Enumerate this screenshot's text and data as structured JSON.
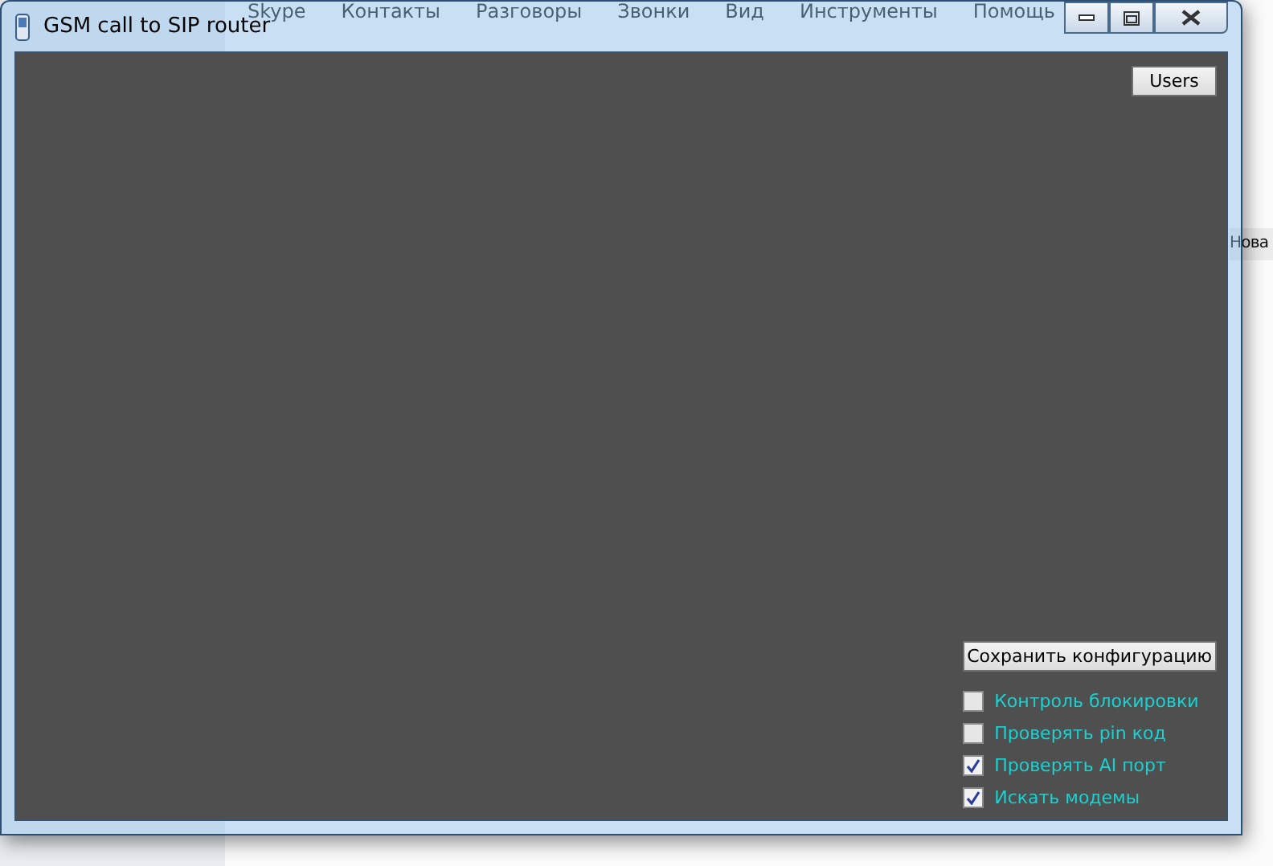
{
  "background_window": {
    "menu": [
      "Skype",
      "Контакты",
      "Разговоры",
      "Звонки",
      "Вид",
      "Инструменты",
      "Помощь"
    ],
    "tab_label": "Нова"
  },
  "window": {
    "title": "GSM call to SIP router"
  },
  "users_button": "Users",
  "save_button": "Сохранить конфигурацию",
  "options": [
    {
      "label": "Контроль блокировки",
      "checked": false
    },
    {
      "label": "Проверять pin код",
      "checked": false
    },
    {
      "label": "Проверять AI порт",
      "checked": true
    },
    {
      "label": "Искать модемы",
      "checked": true
    }
  ]
}
